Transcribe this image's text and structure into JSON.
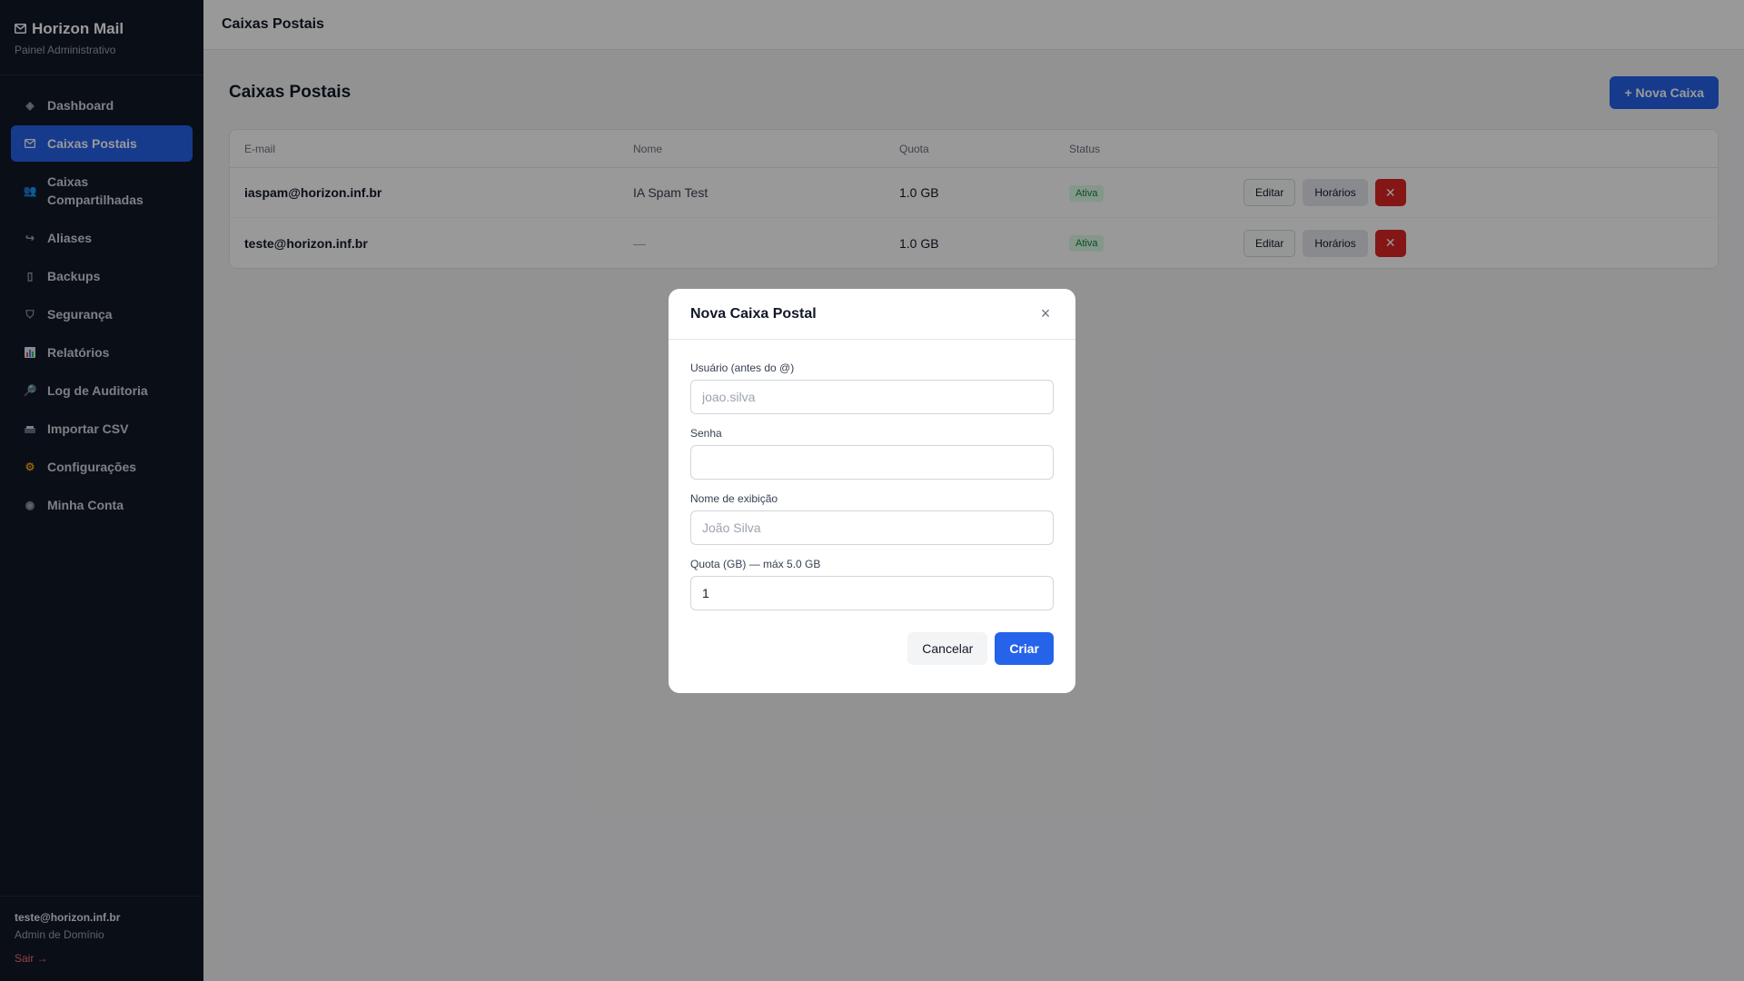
{
  "brand": {
    "icon": "mail-icon",
    "title": "Horizon Mail",
    "subtitle": "Painel Administrativo"
  },
  "sidebar": {
    "items": [
      {
        "icon": "diamond-icon",
        "label": "Dashboard",
        "active": false
      },
      {
        "icon": "mail-icon",
        "label": "Caixas Postais",
        "active": true
      },
      {
        "icon": "users-icon",
        "label": "Caixas",
        "label2": "Compartilhadas",
        "active": false
      },
      {
        "icon": "forward-arrow-icon",
        "label": "Aliases",
        "active": false
      },
      {
        "icon": "backup-icon",
        "label": "Backups",
        "active": false
      },
      {
        "icon": "shield-icon",
        "label": "Segurança",
        "active": false
      },
      {
        "icon": "bar-chart-icon",
        "label": "Relatórios",
        "active": false
      },
      {
        "icon": "magnifier-icon",
        "label": "Log de Auditoria",
        "active": false
      },
      {
        "icon": "import-icon",
        "label": "Importar CSV",
        "active": false
      },
      {
        "icon": "gear-icon",
        "label": "Configurações",
        "active": false
      },
      {
        "icon": "account-icon",
        "label": "Minha Conta",
        "active": false
      }
    ]
  },
  "user": {
    "email": "teste@horizon.inf.br",
    "role": "Admin de Domínio",
    "logout": "Sair →"
  },
  "topbar": {
    "title": "Caixas Postais"
  },
  "main": {
    "title": "Caixas Postais",
    "new_button": "+ Nova Caixa",
    "columns": [
      "E-mail",
      "Nome",
      "Quota",
      "Status"
    ],
    "rows": [
      {
        "email": "iaspam@horizon.inf.br",
        "name": "IA Spam Test",
        "quota": "1.0 GB",
        "status": "Ativa"
      },
      {
        "email": "teste@horizon.inf.br",
        "name": "—",
        "quota": "1.0 GB",
        "status": "Ativa"
      }
    ],
    "row_actions": {
      "edit": "Editar",
      "schedule": "Horários",
      "delete": "✕"
    }
  },
  "modal": {
    "title": "Nova Caixa Postal",
    "close": "×",
    "fields": {
      "user": {
        "label": "Usuário (antes do @)",
        "placeholder": "joao.silva",
        "value": ""
      },
      "password": {
        "label": "Senha",
        "placeholder": "",
        "value": ""
      },
      "display_name": {
        "label": "Nome de exibição",
        "placeholder": "João Silva",
        "value": ""
      },
      "quota": {
        "label": "Quota (GB) — máx 5.0 GB",
        "placeholder": "",
        "value": "1"
      }
    },
    "cancel": "Cancelar",
    "create": "Criar"
  },
  "colors": {
    "accent": "#2563eb",
    "sidebar_bg": "#111827",
    "danger": "#dc2626",
    "success_bg": "#dcfce7",
    "success_text": "#15803d"
  }
}
